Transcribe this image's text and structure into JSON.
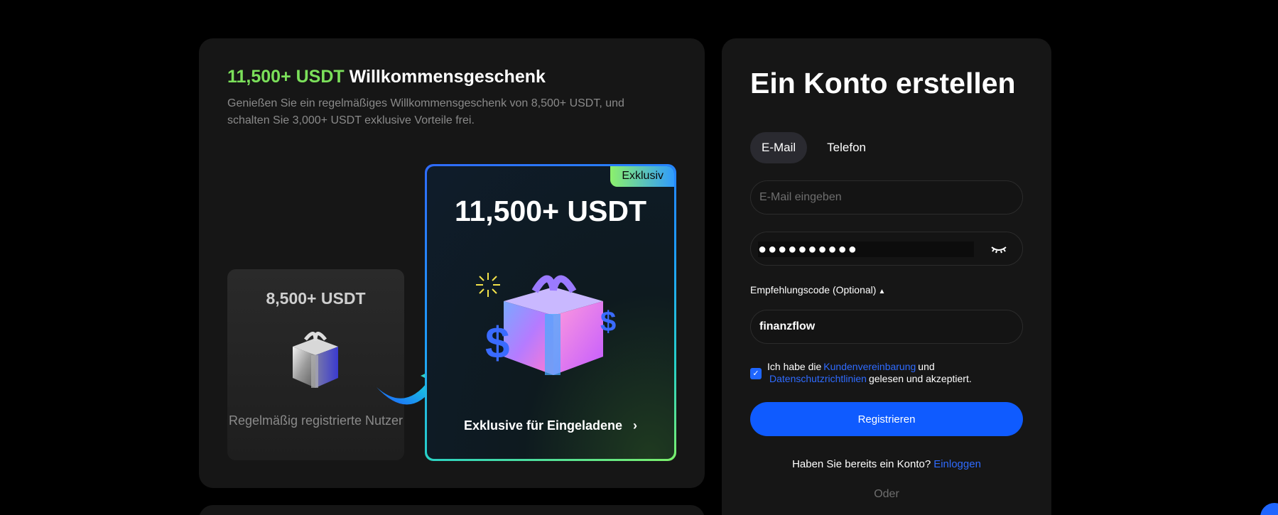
{
  "promo": {
    "title_accent": "11,500+ USDT",
    "title_rest": "Willkommensgeschenk",
    "description": "Genießen Sie ein regelmäßiges Willkommensgeschenk von 8,500+ USDT, und schalten Sie 3,000+ USDT exklusive Vorteile frei.",
    "regular": {
      "amount": "8,500+ USDT",
      "caption": "Regelmäßig registrierte Nutzer"
    },
    "exclusive": {
      "badge": "Exklusiv",
      "amount": "11,500+ USDT",
      "cta": "Exklusive für Eingeladene"
    }
  },
  "signup": {
    "title": "Ein Konto erstellen",
    "tabs": [
      {
        "label": "E-Mail",
        "active": true
      },
      {
        "label": "Telefon",
        "active": false
      }
    ],
    "email_placeholder": "E-Mail eingeben",
    "password_mask": "●●●●●●●●●●",
    "referral_label": "Empfehlungscode (Optional)",
    "referral_value": "finanzflow",
    "consent": {
      "checked": true,
      "part1": "Ich habe die",
      "link1": "Kundenvereinbarung",
      "part2": "und",
      "link2": "Datenschutzrichtlinien",
      "part3": "gelesen und akzeptiert."
    },
    "register_label": "Registrieren",
    "login_prompt": "Haben Sie bereits ein Konto?",
    "login_link": "Einloggen",
    "or_label": "Oder"
  },
  "colors": {
    "accent_green": "#7be05a",
    "primary_blue": "#0f5bff",
    "link_blue": "#2f6bff",
    "card_bg": "#161616",
    "page_bg": "#000000"
  },
  "icons": {
    "eye": "eye-closed-icon",
    "caret": "caret-up-icon",
    "chevron": "chevron-right-icon",
    "check": "check-icon"
  }
}
